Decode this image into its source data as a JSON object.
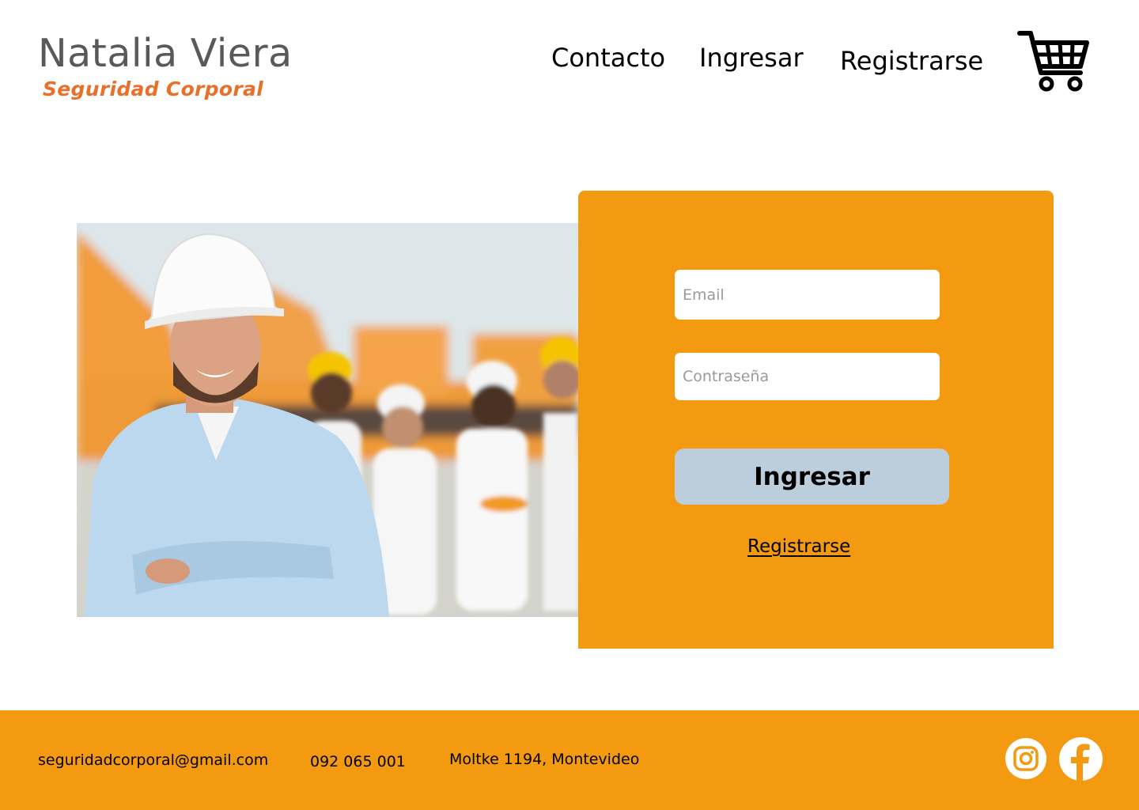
{
  "brand": {
    "name": "Natalia Viera",
    "tagline": "Seguridad Corporal",
    "name_color": "#58595b",
    "tagline_color": "#e8702a"
  },
  "nav": {
    "items": [
      {
        "label": "Contacto"
      },
      {
        "label": "Ingresar"
      },
      {
        "label": "Registrarse"
      }
    ],
    "cart_icon": "shopping-cart-icon"
  },
  "hero": {
    "image": "construction-workers-hard-hats-photo"
  },
  "login": {
    "email_placeholder": "Email",
    "password_placeholder": "Contraseña",
    "submit_label": "Ingresar",
    "register_link": "Registrarse",
    "panel_color": "#f49a11",
    "button_color": "#bccddb"
  },
  "footer": {
    "email": "seguridadcorporal@gmail.com",
    "phone": "092 065 001",
    "address": "Moltke 1194, Montevideo",
    "social": [
      {
        "icon": "instagram-icon"
      },
      {
        "icon": "facebook-icon"
      }
    ],
    "background": "#f49a11"
  }
}
